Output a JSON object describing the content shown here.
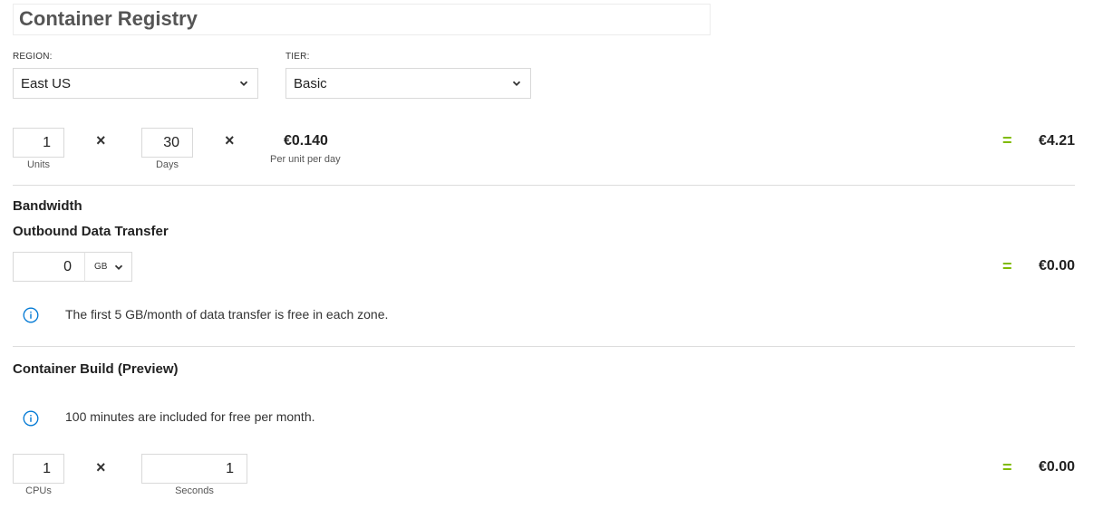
{
  "header": {
    "title": "Container Registry"
  },
  "region": {
    "label": "REGION:",
    "value": "East US"
  },
  "tier": {
    "label": "TIER:",
    "value": "Basic"
  },
  "registry_row": {
    "units_value": "1",
    "units_caption": "Units",
    "days_value": "30",
    "days_caption": "Days",
    "times_symbol": "×",
    "unit_price": "€0.140",
    "unit_price_caption": "Per unit per day",
    "equals": "=",
    "total": "€4.21"
  },
  "bandwidth": {
    "heading": "Bandwidth",
    "subheading": "Outbound Data Transfer",
    "amount_value": "0",
    "unit_value": "GB",
    "equals": "=",
    "total": "€0.00",
    "info_text": "The first 5 GB/month of data transfer is free in each zone."
  },
  "container_build": {
    "heading": "Container Build (Preview)",
    "info_text": "100 minutes are included for free per month.",
    "cpus_value": "1",
    "cpus_caption": "CPUs",
    "times_symbol": "×",
    "seconds_value": "1",
    "seconds_caption": "Seconds",
    "equals": "=",
    "total": "€0.00"
  },
  "icons": {
    "chevron": "chevron-down-icon",
    "info": "info-icon",
    "multiply": "multiply-icon"
  },
  "colors": {
    "accent_equals": "#7fba00",
    "info_blue": "#0078d4"
  }
}
